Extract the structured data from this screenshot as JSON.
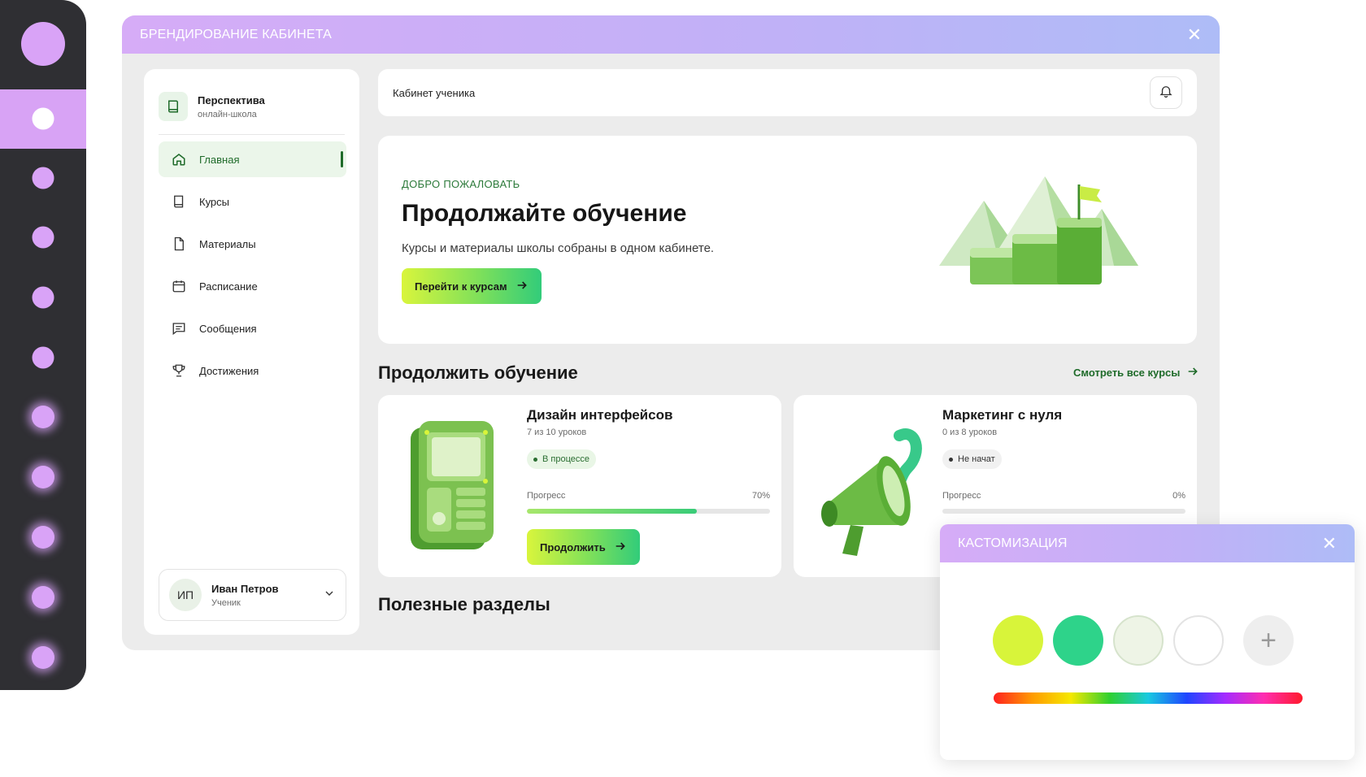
{
  "window": {
    "title": "БРЕНДИРОВАНИЕ КАБИНЕТА",
    "close": "✕"
  },
  "brand": {
    "name": "Перспектива",
    "subtitle": "онлайн-школа"
  },
  "sidebar": {
    "items": [
      {
        "label": "Главная",
        "icon": "home-icon",
        "active": true
      },
      {
        "label": "Курсы",
        "icon": "book-icon",
        "active": false
      },
      {
        "label": "Материалы",
        "icon": "document-icon",
        "active": false
      },
      {
        "label": "Расписание",
        "icon": "calendar-icon",
        "active": false
      },
      {
        "label": "Сообщения",
        "icon": "message-icon",
        "active": false
      },
      {
        "label": "Достижения",
        "icon": "trophy-icon",
        "active": false
      }
    ]
  },
  "user": {
    "initials": "ИП",
    "name": "Иван Петров",
    "role": "Ученик"
  },
  "header": {
    "title": "Кабинет ученика",
    "icon": "bell-icon"
  },
  "hero": {
    "eyebrow": "ДОБРО ПОЖАЛОВАТЬ",
    "title": "Продолжайте обучение",
    "description": "Курсы и материалы школы собраны в одном кабинете.",
    "button": "Перейти к курсам"
  },
  "continue_section": {
    "title": "Продолжить обучение",
    "see_all": "Смотреть все курсы"
  },
  "courses": [
    {
      "title": "Дизайн интерфейсов",
      "lessons": "7 из 10 уроков",
      "status": "В процессе",
      "progress_label": "Прогресс",
      "progress_pct": "70%",
      "progress": 0.7,
      "button": "Продолжить"
    },
    {
      "title": "Маркетинг с нуля",
      "lessons": "0 из 8 уроков",
      "status": "Не начат",
      "progress_label": "Прогресс",
      "progress_pct": "0%",
      "progress": 0
    }
  ],
  "useful_section": {
    "title": "Полезные разделы"
  },
  "customization": {
    "title": "КАСТОМИЗАЦИЯ",
    "close": "✕",
    "swatches": [
      "#d8f43a",
      "#2ed38a",
      "#eef4e6",
      "#ffffff"
    ],
    "add": "+"
  },
  "colors": {
    "accent": "#1f6b2a",
    "rail": "#2f2f33",
    "rail_dot": "#d9a3f7"
  }
}
